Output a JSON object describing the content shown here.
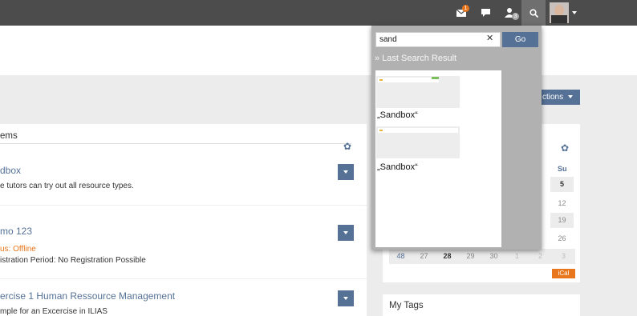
{
  "topbar": {
    "mail_badge": "1",
    "users_badge": "3"
  },
  "actions_label": "ctions",
  "items_panel": {
    "title": "ems",
    "items": [
      {
        "title": "dbox",
        "desc": "e tutors can try out all resource types."
      },
      {
        "title": "mo 123",
        "status": "us: Offline",
        "desc": "istration Period: No Registration Possible"
      },
      {
        "title": "ercise 1 Human Ressource Management",
        "desc": "mple for an Excercise in ILIAS"
      }
    ]
  },
  "calendar": {
    "su_header": "Su",
    "su_col": [
      "5",
      "12",
      "19",
      "26"
    ],
    "partial_col": [
      "",
      "",
      "",
      ":",
      "5"
    ],
    "last_week": {
      "week": "48",
      "days": [
        "27",
        "28",
        "29",
        "30",
        "1",
        "2",
        "3"
      ]
    },
    "ical_label": "iCal"
  },
  "tags": {
    "title": "My Tags"
  },
  "search": {
    "value": "sand",
    "go_label": "Go",
    "last_result_label": "» Last Search Result",
    "results": [
      {
        "label": "„Sandbox“"
      },
      {
        "label": "„Sandbox“"
      }
    ]
  },
  "icons": [
    "mail-icon",
    "chat-icon",
    "users-icon",
    "search-icon",
    "avatar",
    "gear-icon",
    "chevron-down-icon",
    "close-icon"
  ],
  "colors": {
    "accent": "#557196",
    "topbar": "#4c4c4c",
    "badge": "#e8761c",
    "dropdown": "#b1b1b1"
  }
}
